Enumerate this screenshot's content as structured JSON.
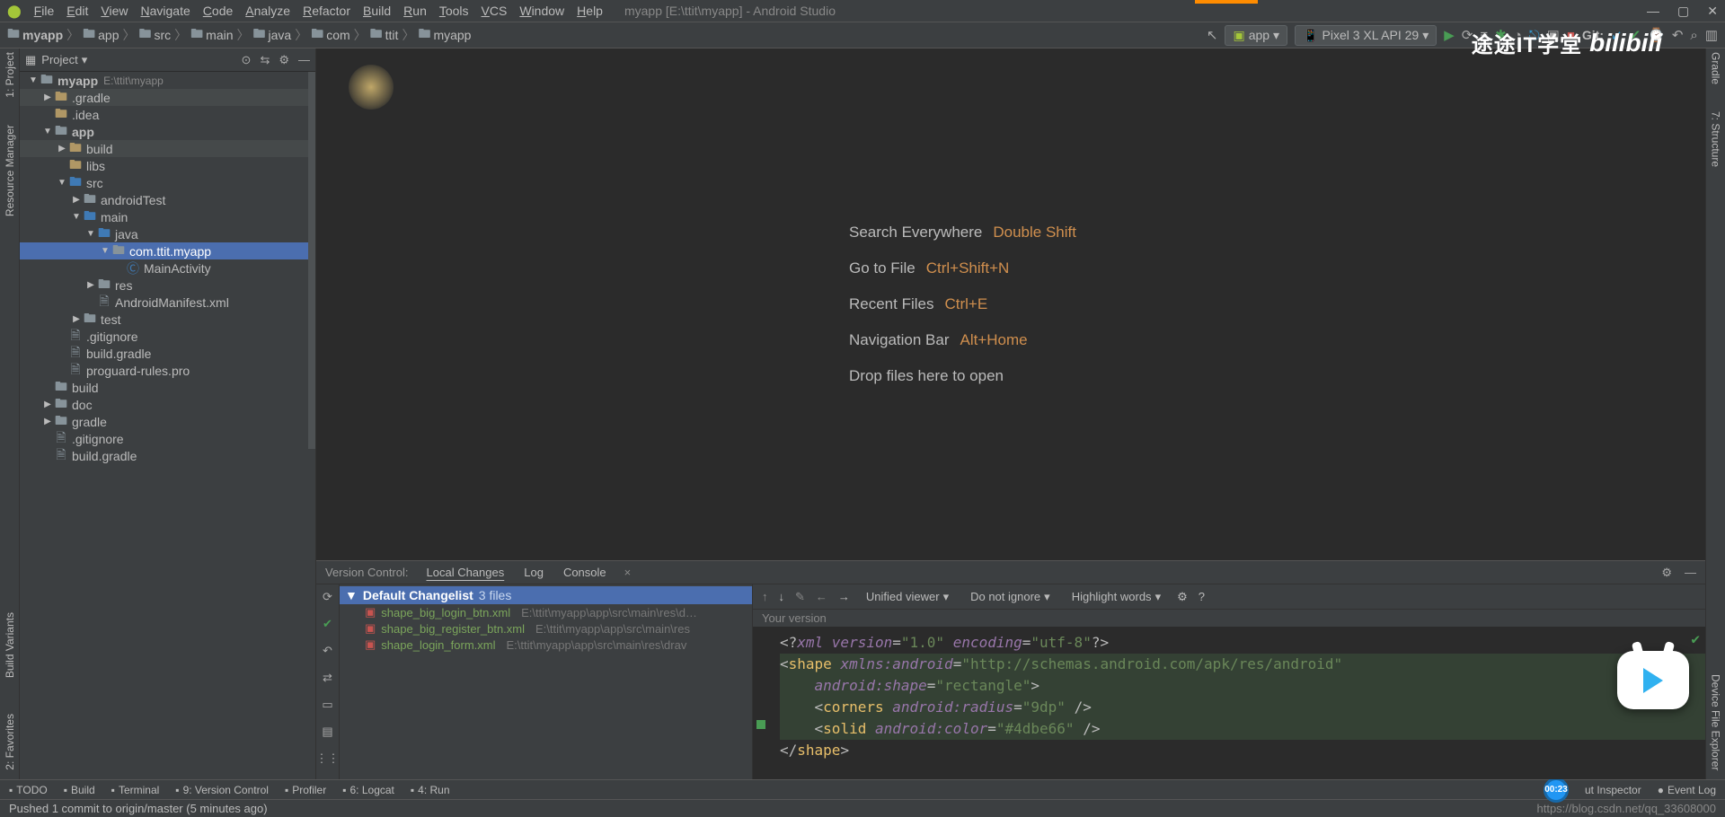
{
  "window": {
    "title": "myapp [E:\\ttit\\myapp] - Android Studio"
  },
  "menu": [
    "File",
    "Edit",
    "View",
    "Navigate",
    "Code",
    "Analyze",
    "Refactor",
    "Build",
    "Run",
    "Tools",
    "VCS",
    "Window",
    "Help"
  ],
  "breadcrumbs": [
    "myapp",
    "app",
    "src",
    "main",
    "java",
    "com",
    "ttit",
    "myapp"
  ],
  "run_config": {
    "app_label": "app",
    "device_label": "Pixel 3 XL API 29"
  },
  "git_label": "Git:",
  "logo": {
    "cn": "途途IT学堂",
    "bili": "bilibili"
  },
  "left_tools": [
    "1: Project",
    "Resource Manager"
  ],
  "right_tools": [
    "Gradle",
    "7: Structure",
    "Device File Explorer"
  ],
  "project_panel": {
    "title": "Project",
    "tree": [
      {
        "depth": 0,
        "arrow": "▼",
        "icon": "folder-gray",
        "label": "myapp",
        "extra": "E:\\ttit\\myapp",
        "bold": true,
        "shaded": false
      },
      {
        "depth": 1,
        "arrow": "▶",
        "icon": "folder-yellow",
        "label": ".gradle",
        "shaded": true
      },
      {
        "depth": 1,
        "arrow": "",
        "icon": "folder-yellow",
        "label": ".idea"
      },
      {
        "depth": 1,
        "arrow": "▼",
        "icon": "folder-gray",
        "label": "app",
        "bold": true
      },
      {
        "depth": 2,
        "arrow": "▶",
        "icon": "folder-yellow",
        "label": "build",
        "shaded": true
      },
      {
        "depth": 2,
        "arrow": "",
        "icon": "folder-yellow",
        "label": "libs"
      },
      {
        "depth": 2,
        "arrow": "▼",
        "icon": "folder-blue",
        "label": "src"
      },
      {
        "depth": 3,
        "arrow": "▶",
        "icon": "folder-gray",
        "label": "androidTest"
      },
      {
        "depth": 3,
        "arrow": "▼",
        "icon": "folder-blue",
        "label": "main"
      },
      {
        "depth": 4,
        "arrow": "▼",
        "icon": "folder-blue",
        "label": "java"
      },
      {
        "depth": 5,
        "arrow": "▼",
        "icon": "folder-gray",
        "label": "com.ttit.myapp",
        "selected": true
      },
      {
        "depth": 6,
        "arrow": "",
        "icon": "class",
        "label": "MainActivity"
      },
      {
        "depth": 4,
        "arrow": "▶",
        "icon": "folder-gray",
        "label": "res"
      },
      {
        "depth": 4,
        "arrow": "",
        "icon": "file",
        "label": "AndroidManifest.xml"
      },
      {
        "depth": 3,
        "arrow": "▶",
        "icon": "folder-gray",
        "label": "test"
      },
      {
        "depth": 2,
        "arrow": "",
        "icon": "file",
        "label": ".gitignore"
      },
      {
        "depth": 2,
        "arrow": "",
        "icon": "file",
        "label": "build.gradle"
      },
      {
        "depth": 2,
        "arrow": "",
        "icon": "file",
        "label": "proguard-rules.pro"
      },
      {
        "depth": 1,
        "arrow": "",
        "icon": "folder-gray",
        "label": "build"
      },
      {
        "depth": 1,
        "arrow": "▶",
        "icon": "folder-gray",
        "label": "doc"
      },
      {
        "depth": 1,
        "arrow": "▶",
        "icon": "folder-gray",
        "label": "gradle"
      },
      {
        "depth": 1,
        "arrow": "",
        "icon": "file",
        "label": ".gitignore"
      },
      {
        "depth": 1,
        "arrow": "",
        "icon": "file",
        "label": "build.gradle"
      }
    ]
  },
  "welcome": [
    {
      "label": "Search Everywhere",
      "shortcut": "Double Shift"
    },
    {
      "label": "Go to File",
      "shortcut": "Ctrl+Shift+N"
    },
    {
      "label": "Recent Files",
      "shortcut": "Ctrl+E"
    },
    {
      "label": "Navigation Bar",
      "shortcut": "Alt+Home"
    },
    {
      "label": "Drop files here to open",
      "shortcut": ""
    }
  ],
  "vc": {
    "label": "Version Control:",
    "tabs": [
      "Local Changes",
      "Log",
      "Console"
    ],
    "changelist": {
      "name": "Default Changelist",
      "count": "3 files"
    },
    "files": [
      {
        "name": "shape_big_login_btn.xml",
        "path": "E:\\ttit\\myapp\\app\\src\\main\\res\\d…"
      },
      {
        "name": "shape_big_register_btn.xml",
        "path": "E:\\ttit\\myapp\\app\\src\\main\\res"
      },
      {
        "name": "shape_login_form.xml",
        "path": "E:\\ttit\\myapp\\app\\src\\main\\res\\drav"
      }
    ],
    "diff_toolbar": {
      "viewer": "Unified viewer",
      "ignore": "Do not ignore",
      "highlight": "Highlight words"
    },
    "your_version": "Your version"
  },
  "code_lines": [
    {
      "cls": "",
      "html": "<span class='tk-punc'>&lt;?</span><span class='tk-ns'>xml version</span><span class='tk-punc'>=</span><span class='tk-str'>\"1.0\"</span> <span class='tk-ns'>encoding</span><span class='tk-punc'>=</span><span class='tk-str'>\"utf-8\"</span><span class='tk-punc'>?&gt;</span>"
    },
    {
      "cls": "green-bg",
      "html": "<span class='tk-punc'>&lt;</span><span class='tk-tag'>shape</span> <span class='tk-ns'>xmlns:android</span><span class='tk-punc'>=</span><span class='tk-str'>\"http://schemas.android.com/apk/res/android\"</span>"
    },
    {
      "cls": "green-bg",
      "html": "    <span class='tk-ns'>android:shape</span><span class='tk-punc'>=</span><span class='tk-str'>\"rectangle\"</span><span class='tk-punc'>&gt;</span>"
    },
    {
      "cls": "green-bg",
      "html": "    <span class='tk-punc'>&lt;</span><span class='tk-tag'>corners</span> <span class='tk-ns'>android:radius</span><span class='tk-punc'>=</span><span class='tk-str'>\"9dp\"</span> <span class='tk-punc'>/&gt;</span>"
    },
    {
      "cls": "green-bg",
      "html": "    <span class='tk-punc'>&lt;</span><span class='tk-tag'>solid</span> <span class='tk-ns'>android:color</span><span class='tk-punc'>=</span><span class='tk-str'>\"#4dbe66\"</span> <span class='tk-punc'>/&gt;</span>"
    },
    {
      "cls": "",
      "html": "<span class='tk-punc'>&lt;/</span><span class='tk-tag'>shape</span><span class='tk-punc'>&gt;</span>"
    }
  ],
  "bottom_tools": [
    "TODO",
    "Build",
    "Terminal",
    "9: Version Control",
    "Profiler",
    "6: Logcat",
    "4: Run"
  ],
  "bottom_right": {
    "layout": "ut Inspector",
    "event": "Event Log",
    "time": "00:23"
  },
  "status": {
    "msg": "Pushed 1 commit to origin/master (5 minutes ago)",
    "url": "https://blog.csdn.net/qq_33608000"
  },
  "left_build_variants": "Build Variants",
  "left_favorites": "2: Favorites"
}
